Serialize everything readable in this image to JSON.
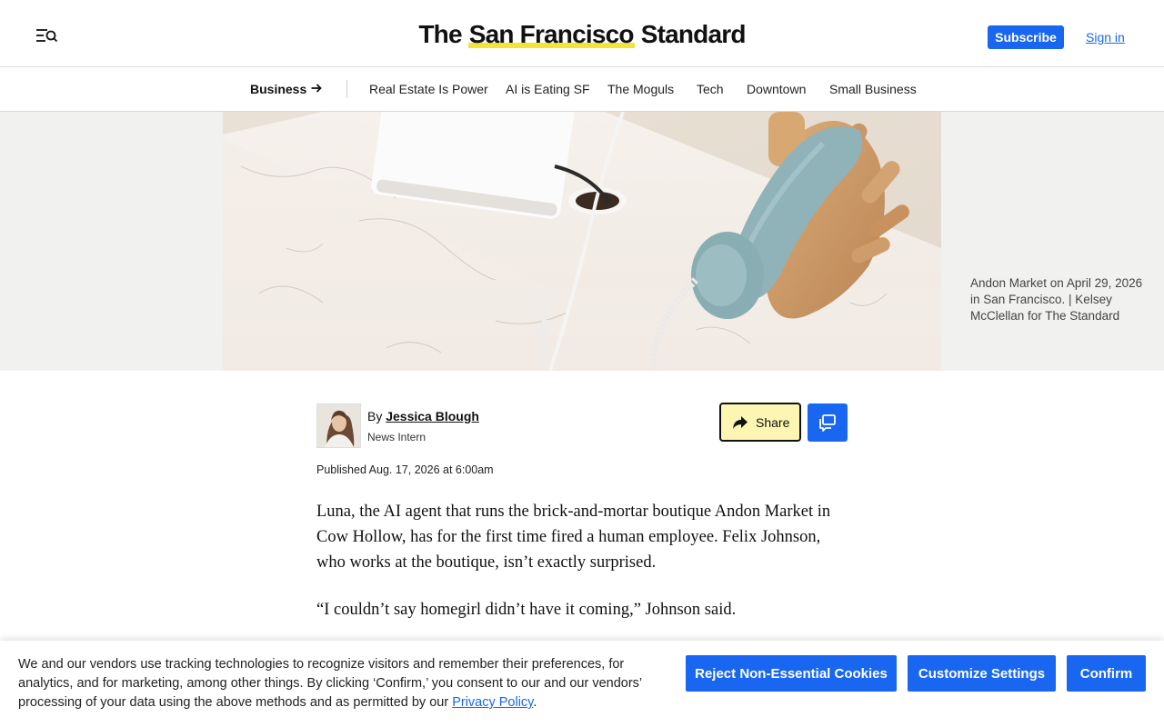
{
  "header": {
    "brand_pre": "The ",
    "brand_highlight": "San Francisco",
    "brand_post": " Standard",
    "subscribe_label": "Subscribe",
    "signin_label": "Sign in",
    "menu_icon": "menu-search-icon"
  },
  "subnav": {
    "section_label": "Business",
    "section_icon": "arrow-right-icon",
    "items": [
      "Real Estate Is Power",
      "AI is Eating SF",
      "The Moguls",
      "Tech",
      "Downtown",
      "Small Business"
    ]
  },
  "hero": {
    "caption": "Andon Market on April 29, 2026 in San Francisco. | Kelsey McClellan for The Standard"
  },
  "article": {
    "by_prefix": "By ",
    "author_name": "Jessica Blough",
    "author_role": "News Intern",
    "share_label": "Share",
    "published": "Published Aug. 17, 2026 at 6:00am",
    "paragraphs": [
      "Luna, the AI agent that runs the brick-and-mortar boutique Andon Market in Cow Hollow, has for the first time fired a human employee. Felix Johnson, who works at the boutique, isn’t exactly surprised.",
      "“I couldn’t say homegirl didn’t have it coming,” Johnson said."
    ]
  },
  "cookie_banner": {
    "text": "We and our vendors use tracking technologies to recognize visitors and remember their preferences, for analytics, and for marketing, among other things. By clicking ‘Confirm,’ you consent to our and our vendors’ processing of your data using the above methods and as permitted by our ",
    "link_label": "Privacy Policy",
    "text_end": ".",
    "reject_label": "Reject Non-Essential Cookies",
    "customize_label": "Customize Settings",
    "confirm_label": "Confirm"
  },
  "colors": {
    "accent": "#1967f0",
    "brand_highlight": "#f3e43a",
    "share_bg": "#fdf6b3"
  }
}
